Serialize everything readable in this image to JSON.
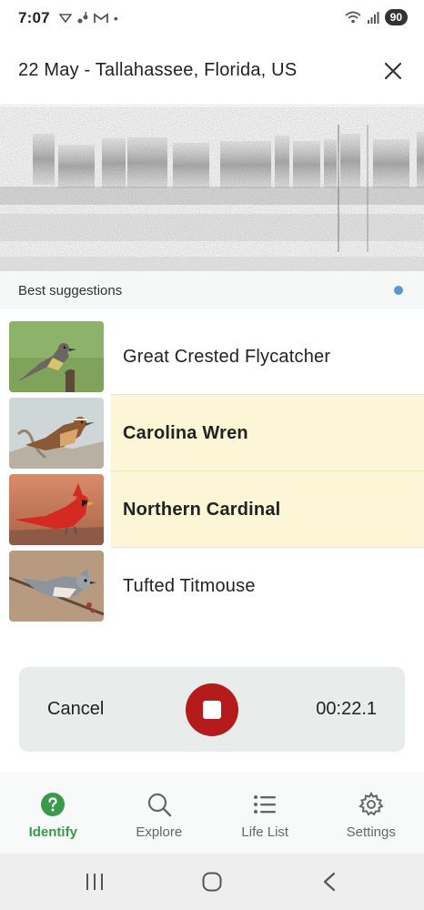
{
  "status": {
    "time": "7:07",
    "battery": "90"
  },
  "header": {
    "title": "22 May - Tallahassee, Florida, US",
    "close_icon": "close-icon"
  },
  "suggestions": {
    "title": "Best suggestions",
    "items": [
      {
        "name": "Great Crested Flycatcher",
        "highlighted": false
      },
      {
        "name": "Carolina Wren",
        "highlighted": true
      },
      {
        "name": "Northern Cardinal",
        "highlighted": true
      },
      {
        "name": "Tufted Titmouse",
        "highlighted": false
      }
    ]
  },
  "recording": {
    "cancel_label": "Cancel",
    "timer": "00:22.1",
    "stop_icon": "stop-icon"
  },
  "nav": {
    "items": [
      {
        "label": "Identify",
        "icon": "help-circle-icon",
        "active": true
      },
      {
        "label": "Explore",
        "icon": "search-icon",
        "active": false
      },
      {
        "label": "Life List",
        "icon": "list-icon",
        "active": false
      },
      {
        "label": "Settings",
        "icon": "gear-icon",
        "active": false
      }
    ]
  },
  "colors": {
    "accent_green": "#3a9a4a",
    "record_red": "#b51b1b",
    "highlight": "#fdf6d6",
    "dot_blue": "#5b97d6"
  }
}
